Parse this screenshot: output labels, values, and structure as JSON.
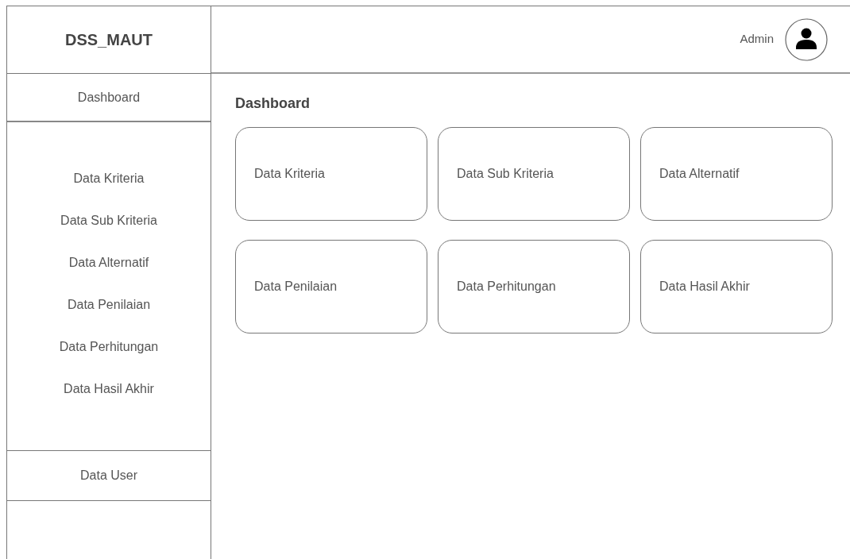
{
  "app_title": "DSS_MAUT",
  "user": {
    "name": "Admin"
  },
  "sidebar": {
    "top_item": "Dashboard",
    "items": [
      "Data Kriteria",
      "Data Sub Kriteria",
      "Data Alternatif",
      "Data Penilaian",
      "Data Perhitungan",
      "Data Hasil Akhir"
    ],
    "bottom_item": "Data User"
  },
  "page_title": "Dashboard",
  "cards": [
    "Data Kriteria",
    "Data Sub Kriteria",
    "Data Alternatif",
    "Data Penilaian",
    "Data Perhitungan",
    "Data Hasil Akhir"
  ]
}
